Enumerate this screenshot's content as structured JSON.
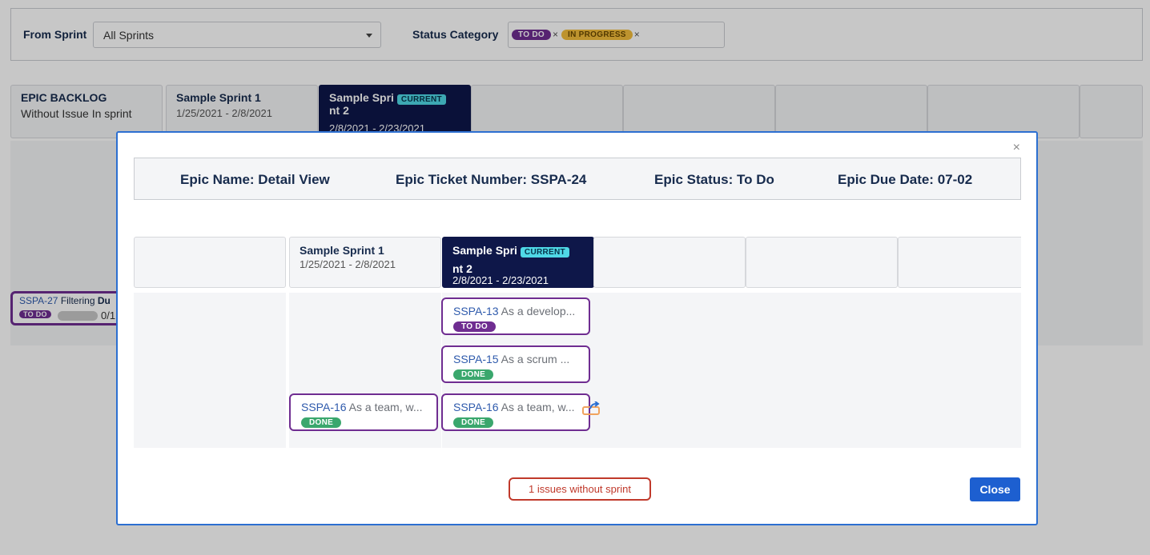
{
  "filters": {
    "from_sprint_label": "From Sprint",
    "from_sprint_value": "All Sprints",
    "status_category_label": "Status Category",
    "status_chips": [
      "TO DO",
      "IN PROGRESS"
    ],
    "chip_remove": "×"
  },
  "background_board": {
    "columns": [
      {
        "title": "EPIC BACKLOG",
        "subtitle": "Without Issue In sprint"
      },
      {
        "title": "Sample Sprint 1",
        "dates": "1/25/2021 - 2/8/2021"
      },
      {
        "title_line1": "Sample Spri",
        "title_line2": "nt 2",
        "badge": "CURRENT",
        "dates": "2/8/2021 - 2/23/2021"
      }
    ],
    "card": {
      "id": "SSPA-27",
      "text": "Filtering",
      "text_bold": "Du",
      "status": "TO DO",
      "count": "0/1"
    }
  },
  "modal": {
    "close_x": "×",
    "epic_name": "Epic Name: Detail View",
    "epic_ticket": "Epic Ticket Number: SSPA-24",
    "epic_status": "Epic Status: To Do",
    "epic_due": "Epic Due Date: 07-02",
    "columns": [
      {
        "title": "",
        "dates": ""
      },
      {
        "title": "Sample Sprint 1",
        "dates": "1/25/2021 - 2/8/2021"
      },
      {
        "title_line1": "Sample Spri",
        "title_line2": "nt 2",
        "badge": "CURRENT",
        "dates": "2/8/2021 - 2/23/2021"
      }
    ],
    "issues": [
      {
        "id": "SSPA-16",
        "text": "As a team, w...",
        "status": "DONE"
      },
      {
        "id": "SSPA-13",
        "text": "As a develop...",
        "status": "TO DO"
      },
      {
        "id": "SSPA-15",
        "text": "As a scrum ...",
        "status": "DONE"
      },
      {
        "id": "SSPA-16",
        "text": "As a team, w...",
        "status": "DONE"
      }
    ],
    "no_sprint_button": "1 issues without sprint",
    "close_button": "Close"
  },
  "icons": {
    "move_icon": "rotate-arrow-icon"
  },
  "colors": {
    "epic_border": "#6f2d91",
    "current_sprint_bg": "#0e1749",
    "current_badge": "#4fd8e6",
    "done": "#3aa76d",
    "todo": "#6f2d91",
    "in_progress": "#f2bd3b",
    "primary_button": "#1d5fd0",
    "warning": "#c0392b"
  }
}
